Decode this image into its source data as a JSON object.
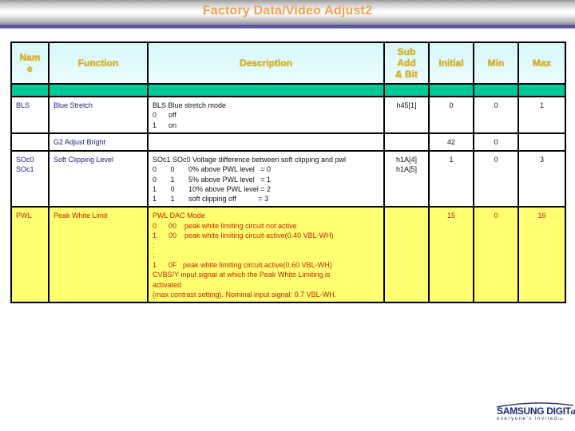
{
  "page": {
    "title": "Factory Data/Video Adjust2"
  },
  "table": {
    "headers": {
      "name": "Nam\ne",
      "function": "Function",
      "description": "Description",
      "sub_addr": "Sub\nAdd\n& Bit",
      "initial": "Initial",
      "min": "Min",
      "max": "Max"
    },
    "rows": [
      {
        "name": "BLS",
        "function": "Blue Stretch",
        "description": "BLS Blue stretch mode\n0      off\n1      on",
        "sub_addr": "h45[1]",
        "initial": "0",
        "min": "0",
        "max": "1"
      },
      {
        "name": "",
        "function": "G2 Adjust Bright",
        "description": "",
        "sub_addr": "",
        "initial": "42",
        "min": "0",
        "max": ""
      },
      {
        "name": "SOc0\nSOc1",
        "function": "Soft Clipping Level",
        "description": "SOc1 SOc0 Voltage difference between soft clipping and pwl\n0       0       0% above PWL level   = 0\n0       1       5% above PWL level   = 1\n1       0       10% above PWL level = 2\n1       1       soft clipping off           = 3",
        "sub_addr": "h1A[4]\nh1A[5]",
        "initial": "1",
        "min": "0",
        "max": "3"
      },
      {
        "name": "PWL",
        "function": "Peak White Limit",
        "description": "PWL DAC Mode\n0      00    peak white limiting circuit not active\n1      00    peak white limiting circuit active(0.40 VBL-WH)\n:\n:\n1      0F   peak white limiting circuit active(0.60 VBL-WH)\nCVBS/Y input signal at which the Peak White Limiting is\nactivated\n(max contrast setting). Nominal input signal: 0.7 VBL-WH.",
        "sub_addr": "",
        "initial": "15",
        "min": "0",
        "max": "16"
      }
    ]
  },
  "logo": {
    "brand": "SAMSUNG DIGIT",
    "brand_suffix": "all",
    "tagline": "everyone's invited",
    "tm": "TM"
  }
}
